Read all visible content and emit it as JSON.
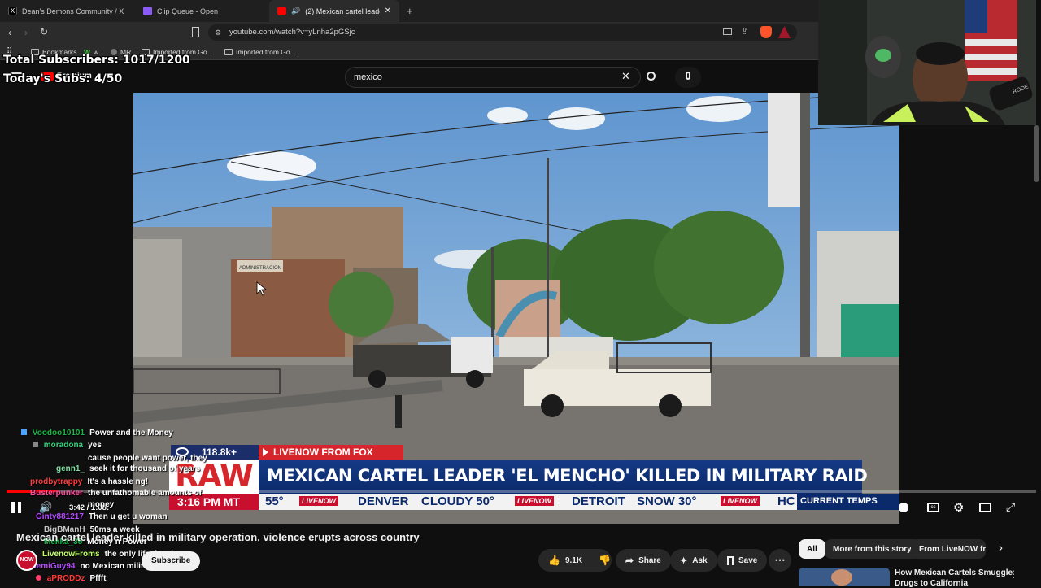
{
  "browser": {
    "tabs": [
      {
        "label": "Dean's Demons Community / X"
      },
      {
        "label": "Clip Queue - Open"
      },
      {
        "label": "(2) Mexican cartel leader kille"
      }
    ],
    "new_tab_icon": "plus-icon",
    "url": "youtube.com/watch?v=yLnha2pGSjc",
    "bookmarks": [
      {
        "label": "Bookmarks"
      },
      {
        "label": "w"
      },
      {
        "label": "MR"
      },
      {
        "label": "Imported from Go..."
      },
      {
        "label": "Imported from Go..."
      }
    ]
  },
  "stream_overlay": {
    "total_subs": "Total Subscribers: 1017/1200",
    "today_subs": "Today's Subs: 4/50",
    "premium_label": "Premium"
  },
  "youtube": {
    "search_value": "mexico",
    "video_title": "Mexican cartel leader killed in military operation, violence erupts across country",
    "channel_logo": "NOW",
    "subscribe_label": "Subscribe",
    "likes": "9.1K",
    "share_label": "Share",
    "ask_label": "Ask",
    "save_label": "Save",
    "chips": [
      {
        "label": "All"
      },
      {
        "label": "More from this story"
      },
      {
        "label": "From LiveNOW from"
      }
    ],
    "rec_title": "How Mexican Cartels Smuggle",
    "rec_title_2": "Drugs to California",
    "time_display": "3:42 / 1:08:"
  },
  "news_graphic": {
    "views": "118.8k+",
    "source_tag": "LIVENOW FROM FOX",
    "raw_label": "RAW",
    "headline": "MEXICAN CARTEL LEADER 'EL MENCHO' KILLED IN MILITARY RAID",
    "clock": "3:16 PM MT",
    "ticker": [
      {
        "city": "55°"
      },
      {
        "city": "DENVER",
        "cond": "CLOUDY 50°"
      },
      {
        "city": "DETROIT",
        "cond": "SNOW 30°"
      },
      {
        "city": "HC"
      }
    ],
    "livenow_logo": "LIVENOW",
    "current_temps": "CURRENT TEMPS",
    "storefront_sign": "ADMINISTRACION"
  },
  "chat": [
    {
      "name": "Voodoo10101",
      "msg": "Power and the Money",
      "color": "#1eb34b"
    },
    {
      "name": "moradona",
      "msg": "yes",
      "color": "#2fd17a"
    },
    {
      "name": "",
      "msg": "cause people want power, they",
      "color": "#ffffff"
    },
    {
      "name": "genn1_",
      "msg": "seek it for thousand of years",
      "color": "#7ee0a0"
    },
    {
      "name": "prodbytrappy",
      "msg": "It's a hassle ng!",
      "color": "#ff3b3b"
    },
    {
      "name": "Busterpunker",
      "msg": "the unfathomable amounts of",
      "color": "#ff4fa0"
    },
    {
      "name": "",
      "msg": "money",
      "color": "#ffffff"
    },
    {
      "name": "Ginty881217",
      "msg": "Then u get u woman",
      "color": "#b64cff"
    },
    {
      "name": "BigBManH",
      "msg": "50ms a week",
      "color": "#c8c8c8"
    },
    {
      "name": "Mekka_35",
      "msg": "Money n Power",
      "color": "#1eb34b"
    },
    {
      "name": "LivenowFroms",
      "msg": "the only life they know",
      "color": "#c0ff6a"
    },
    {
      "name": "SemiGuy94",
      "msg": "no Mexican military",
      "color": "#b64cff"
    },
    {
      "name": "aPRODDz",
      "msg": "Pffft",
      "color": "#ff3b3b"
    }
  ],
  "colors": {
    "raw_red": "#d7262b",
    "banner_blue": "#0b2a6b",
    "ticker_red": "#c8102e",
    "progress_red": "#ff0000"
  },
  "playback": {
    "progress": 0.05
  }
}
